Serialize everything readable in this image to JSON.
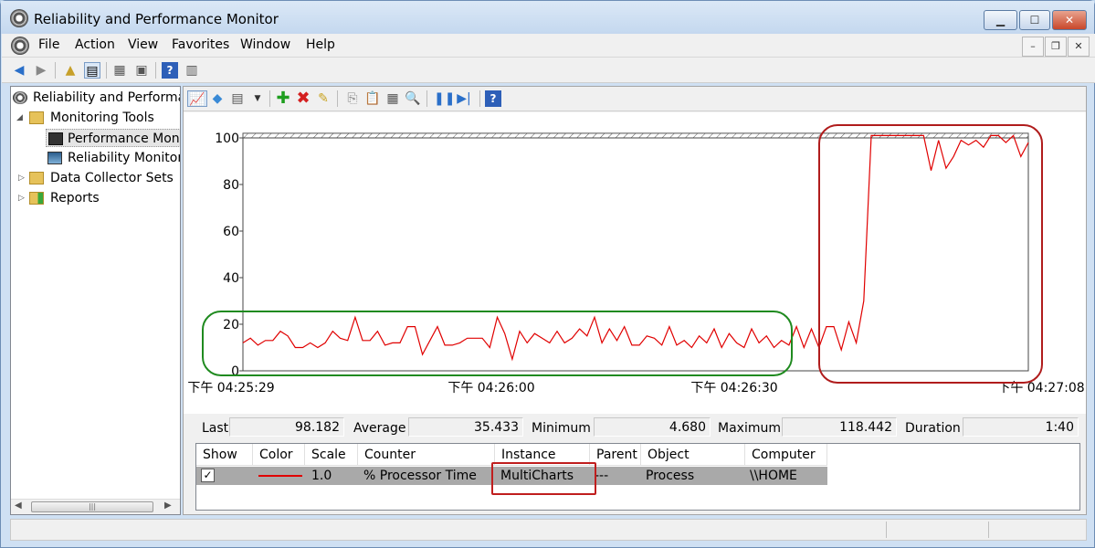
{
  "window": {
    "title": "Reliability and Performance Monitor"
  },
  "menubar": {
    "items": [
      "File",
      "Action",
      "View",
      "Favorites",
      "Window",
      "Help"
    ]
  },
  "tree": {
    "items": [
      {
        "label": "Reliability and Performance Monitor",
        "icon": "monitor-icon"
      },
      {
        "label": "Monitoring Tools",
        "icon": "folder-icon"
      },
      {
        "label": "Performance Monitor",
        "icon": "perfmon-icon"
      },
      {
        "label": "Reliability Monitor",
        "icon": "reliability-icon"
      },
      {
        "label": "Data Collector Sets",
        "icon": "folder-icon"
      },
      {
        "label": "Reports",
        "icon": "reports-icon"
      }
    ]
  },
  "stats": {
    "last_label": "Last",
    "last_value": "98.182",
    "average_label": "Average",
    "average_value": "35.433",
    "minimum_label": "Minimum",
    "minimum_value": "4.680",
    "maximum_label": "Maximum",
    "maximum_value": "118.442",
    "duration_label": "Duration",
    "duration_value": "1:40"
  },
  "legend": {
    "headers": [
      "Show",
      "Color",
      "Scale",
      "Counter",
      "Instance",
      "Parent",
      "Object",
      "Computer"
    ],
    "row": {
      "scale": "1.0",
      "counter": "% Processor Time",
      "instance": "MultiCharts",
      "parent": "---",
      "object": "Process",
      "computer": "\\\\HOME",
      "color": "#e00000"
    }
  },
  "highlight_colors": {
    "green": "#1f8a1f",
    "red": "#b01c1c"
  },
  "chart_data": {
    "type": "line",
    "series_color": "#e00000",
    "ylim": [
      0,
      100
    ],
    "y_ticks": [
      0,
      20,
      40,
      60,
      80,
      100
    ],
    "x_tick_labels": [
      "下午 04:25:29",
      "下午 04:26:00",
      "下午 04:26:30",
      "下午 04:27:08"
    ],
    "grid": false,
    "values": [
      12,
      14,
      11,
      13,
      13,
      17,
      15,
      10,
      10,
      12,
      10,
      12,
      17,
      14,
      13,
      23,
      13,
      13,
      17,
      11,
      12,
      12,
      19,
      19,
      7,
      13,
      19,
      11,
      11,
      12,
      14,
      14,
      14,
      10,
      23,
      16,
      5,
      17,
      12,
      16,
      14,
      12,
      17,
      12,
      14,
      18,
      15,
      23,
      12,
      18,
      13,
      19,
      11,
      11,
      15,
      14,
      11,
      19,
      11,
      13,
      10,
      15,
      12,
      18,
      10,
      16,
      12,
      10,
      18,
      12,
      15,
      10,
      13,
      11,
      19,
      10,
      18,
      10,
      19,
      19,
      9,
      21,
      12,
      30,
      101,
      101,
      101,
      101,
      101,
      101,
      101,
      101,
      86,
      99,
      87,
      92,
      99,
      97,
      99,
      96,
      101,
      101,
      98,
      101,
      92,
      98
    ],
    "y_overflow_band": [
      100,
      102
    ]
  }
}
